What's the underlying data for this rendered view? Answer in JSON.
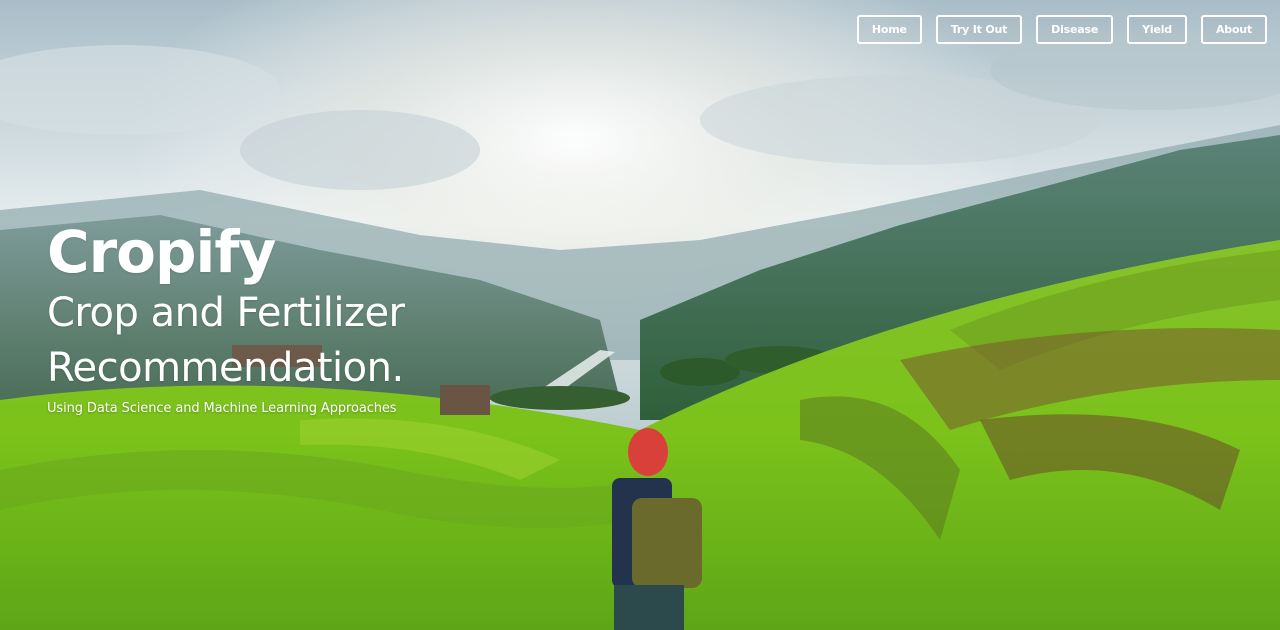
{
  "nav": {
    "items": [
      {
        "label": "Home"
      },
      {
        "label": "Try It Out"
      },
      {
        "label": "Disease"
      },
      {
        "label": "Yield"
      },
      {
        "label": "About"
      }
    ]
  },
  "hero": {
    "title": "Cropify",
    "subtitle_line1": "Crop and Fertilizer",
    "subtitle_line2": "Recommendation.",
    "tagline": "Using Data Science and Machine Learning Approaches"
  },
  "colors": {
    "text": "#ffffff",
    "sky": "#dfe9ec",
    "field_green": "#8ccc2a",
    "hills": "#4d7f68"
  }
}
